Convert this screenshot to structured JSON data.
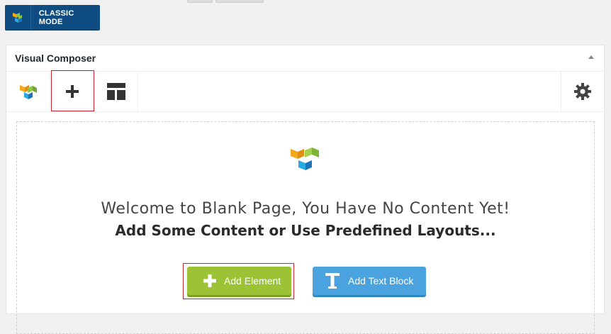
{
  "top": {
    "classic_mode_label": "CLASSIC MODE"
  },
  "panel": {
    "title": "Visual Composer",
    "toolbar": {
      "items": [
        {
          "name": "vc-logo-icon"
        },
        {
          "name": "plus-icon"
        },
        {
          "name": "templates-icon"
        }
      ],
      "settings_icon": "gear-icon"
    }
  },
  "canvas": {
    "welcome_line1": "Welcome to Blank Page, You Have No Content Yet!",
    "welcome_line2": "Add Some Content or Use Predefined Layouts...",
    "add_element_label": "Add Element",
    "add_text_block_label": "Add Text Block"
  },
  "colors": {
    "classic_btn_bg": "#0f4c81",
    "add_element_bg": "#9cc235",
    "add_text_block_bg": "#4aa3df",
    "highlight_border": "#c9252f"
  }
}
